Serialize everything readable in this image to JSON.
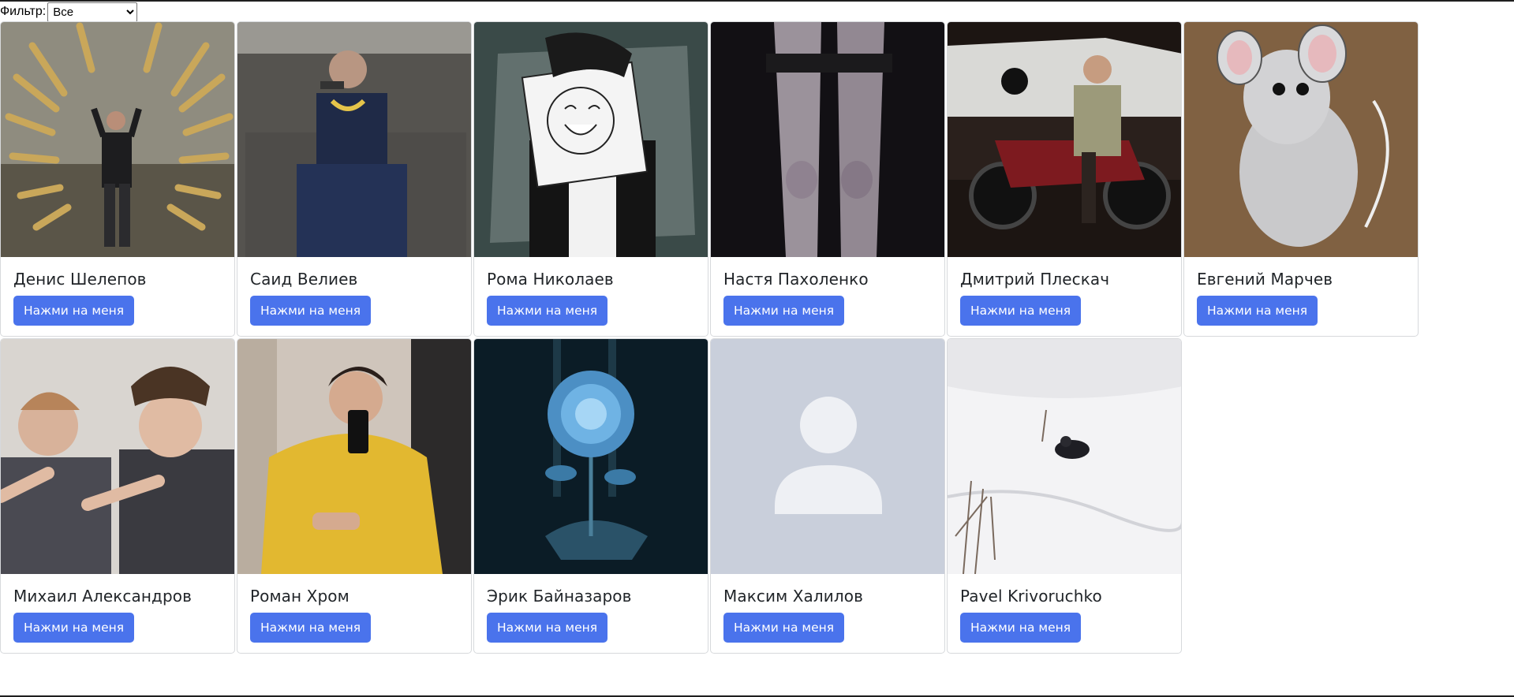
{
  "filter": {
    "label": "Фильтр:",
    "selected": "Все"
  },
  "cards": [
    {
      "name": "Денис Шелепов",
      "button": "Нажми на меня",
      "photo": "man-in-golden-swords-portal"
    },
    {
      "name": "Саид Велиев",
      "button": "Нажми на меня",
      "photo": "man-on-couch-with-pistol"
    },
    {
      "name": "Рома Николаев",
      "button": "Нажми на меня",
      "photo": "anime-paper-face-drawing"
    },
    {
      "name": "Настя Пахоленко",
      "button": "Нажми на меня",
      "photo": "blurry-legs-dark"
    },
    {
      "name": "Дмитрий Плескач",
      "button": "Нажми на меня",
      "photo": "man-on-motorcycle-night"
    },
    {
      "name": "Евгений Марчев",
      "button": "Нажми на меня",
      "photo": "cartoon-rat"
    },
    {
      "name": "Михаил Александров",
      "button": "Нажми на меня",
      "photo": "two-men-pointing"
    },
    {
      "name": "Роман Хром",
      "button": "Нажми на меня",
      "photo": "mirror-selfie-yellow-jacket"
    },
    {
      "name": "Эрик Байназаров",
      "button": "Нажми на меня",
      "photo": "blue-crystal-rose"
    },
    {
      "name": "Максим Халилов",
      "button": "Нажми на меня",
      "photo": "default-avatar-placeholder"
    },
    {
      "name": "Pavel Krivoruchko",
      "button": "Нажми на меня",
      "photo": "person-sledding-in-snow"
    }
  ],
  "colors": {
    "button": "#4a73ec",
    "placeholder_bg": "#c9cfdb",
    "placeholder_fg": "#eef0f4"
  }
}
